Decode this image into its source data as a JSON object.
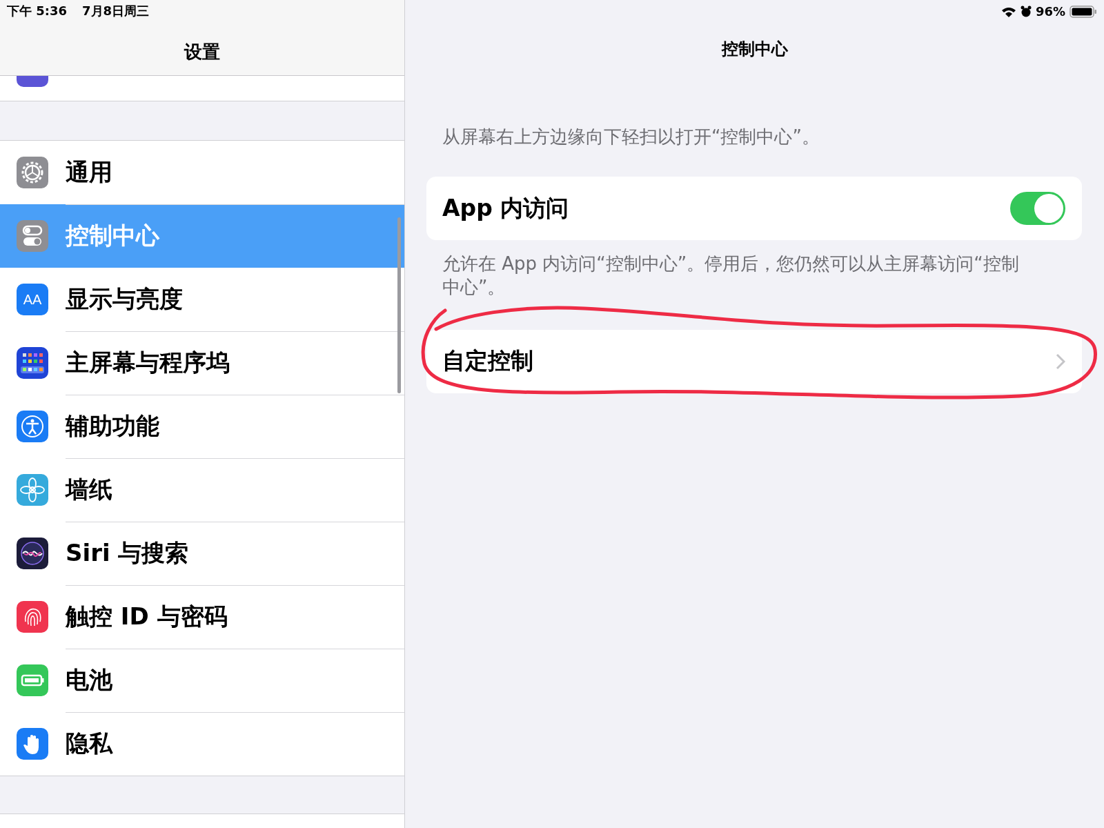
{
  "status_bar": {
    "time": "下午 5:36",
    "date": "7月8日周三",
    "battery_percent": "96%"
  },
  "sidebar": {
    "title": "设置",
    "items": [
      {
        "label": "通用",
        "kind": "gear",
        "selected": false
      },
      {
        "label": "控制中心",
        "kind": "switches",
        "selected": true
      },
      {
        "label": "显示与亮度",
        "kind": "text-size",
        "icon_text": "AA",
        "selected": false
      },
      {
        "label": "主屏幕与程序坞",
        "kind": "grid",
        "selected": false
      },
      {
        "label": "辅助功能",
        "kind": "accessibility",
        "selected": false
      },
      {
        "label": "墙纸",
        "kind": "flower",
        "selected": false
      },
      {
        "label": "Siri 与搜索",
        "kind": "siri",
        "selected": false
      },
      {
        "label": "触控 ID 与密码",
        "kind": "fingerprint",
        "selected": false
      },
      {
        "label": "电池",
        "kind": "battery",
        "selected": false
      },
      {
        "label": "隐私",
        "kind": "hand",
        "selected": false
      }
    ]
  },
  "detail": {
    "title": "控制中心",
    "description": "从屏幕右上方边缘向下轻扫以打开“控制中心”。",
    "toggle_row": {
      "label": "App 内访问",
      "on": true
    },
    "footer": "允许在 App 内访问“控制中心”。停用后，您仍然可以从主屏幕访问“控制中心”。",
    "nav_row": {
      "label": "自定控制"
    }
  }
}
